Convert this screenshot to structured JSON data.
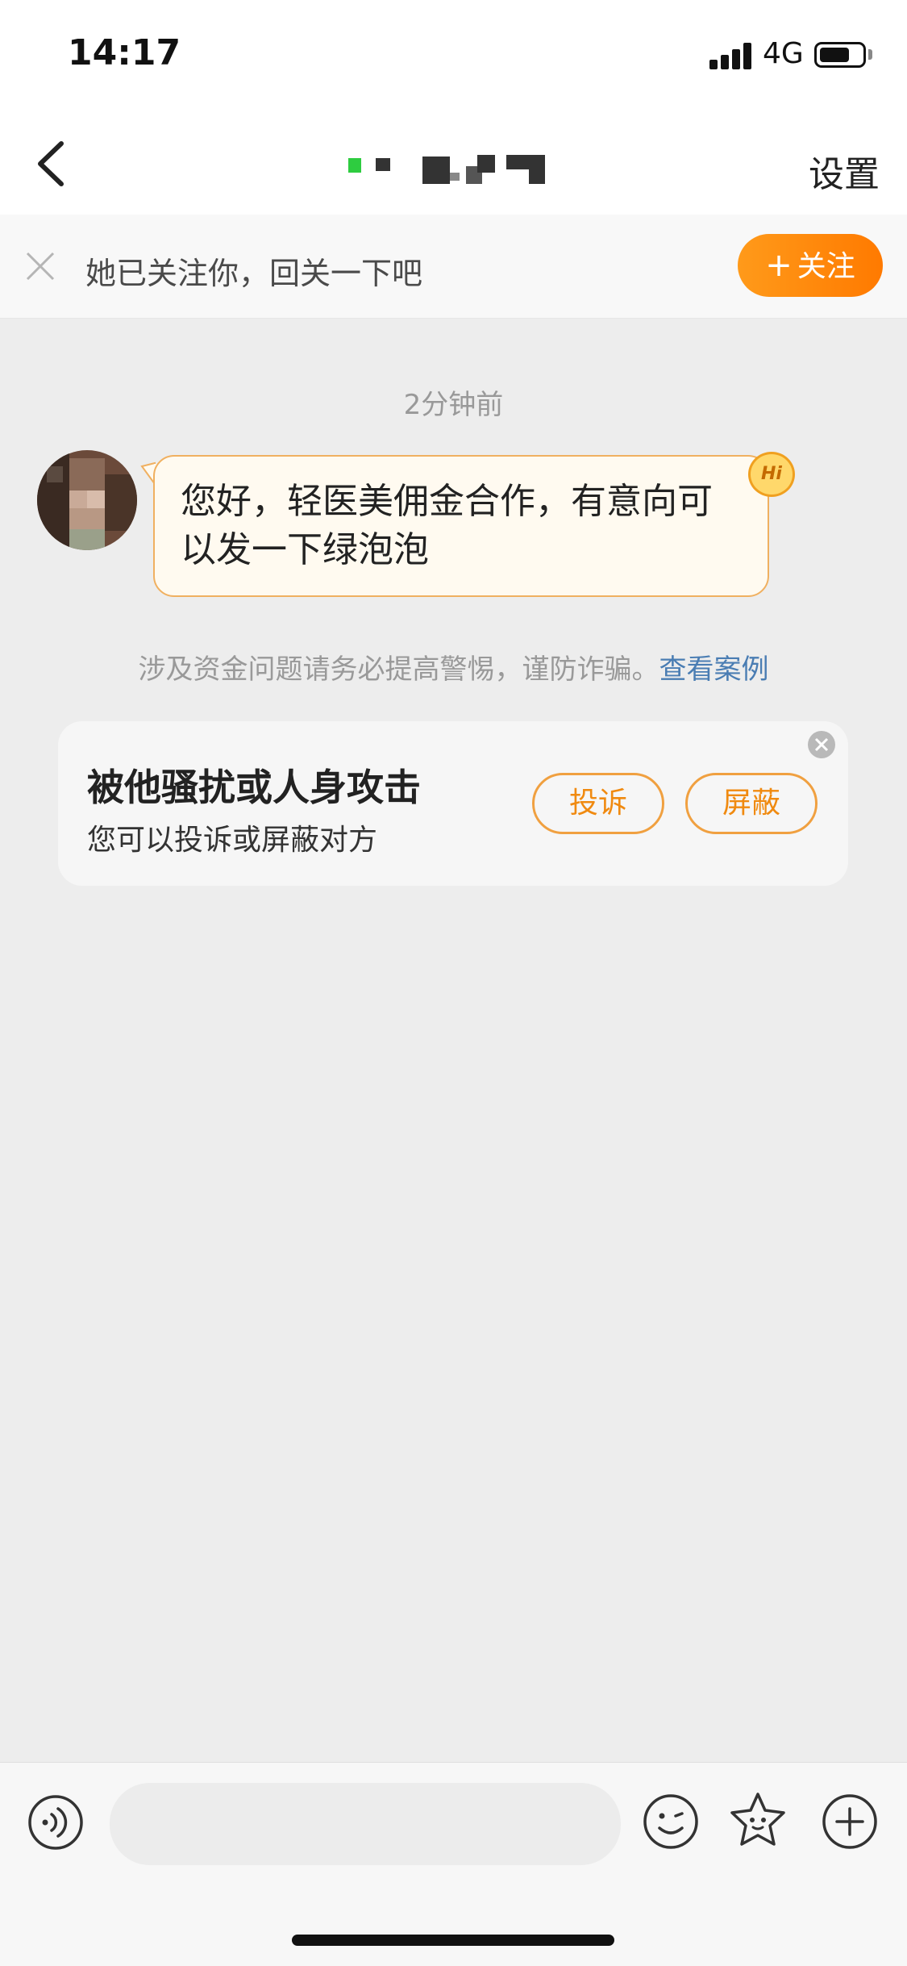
{
  "status_bar": {
    "time": "14:17",
    "network": "4G",
    "battery_level": 0.7
  },
  "nav": {
    "settings_label": "设置",
    "back_icon": "chevron-left-icon"
  },
  "follow_banner": {
    "text": "她已关注你，回关一下吧",
    "button_label": "关注",
    "button_plus": "+",
    "accent": "#ff8a0a"
  },
  "chat": {
    "timestamp": "2分钟前",
    "message": "您好，轻医美佣金合作，有意向可以发一下绿泡泡",
    "badge": "Hi"
  },
  "warning": {
    "text": "涉及资金问题请务必提高警惕，谨防诈骗。",
    "link": "查看案例",
    "link_color": "#4a7db3"
  },
  "harassment_card": {
    "title": "被他骚扰或人身攻击",
    "subtitle": "您可以投诉或屏蔽对方",
    "report_label": "投诉",
    "block_label": "屏蔽"
  },
  "input_bar": {
    "icons": [
      "voice-icon",
      "emoji-icon",
      "sticker-icon",
      "plus-icon"
    ]
  }
}
